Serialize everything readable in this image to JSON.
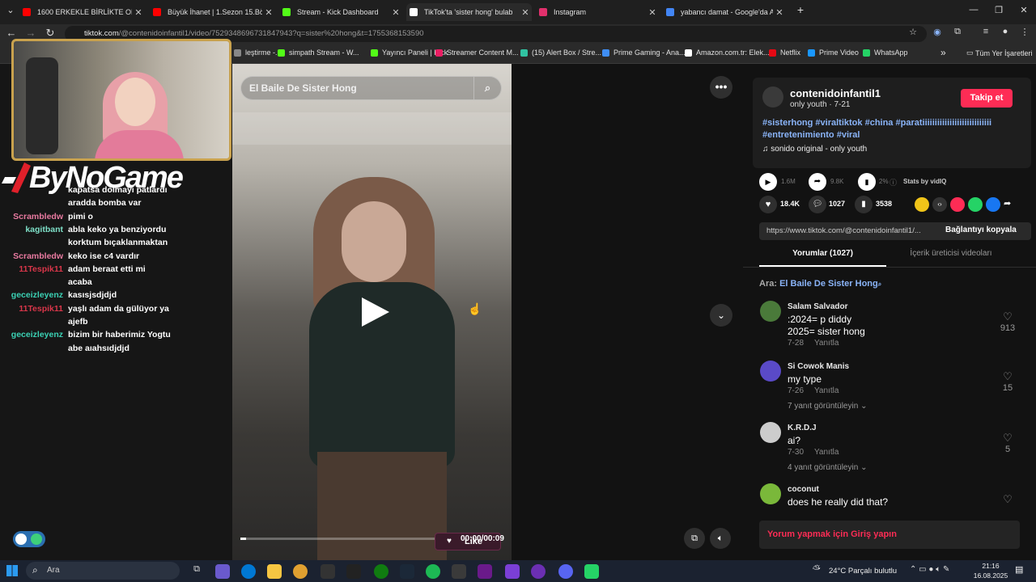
{
  "tabs": [
    {
      "label": "1600 ERKEKLE BİRLİKTE OLUP K",
      "color": "#ff0000"
    },
    {
      "label": "Büyük İhanet | 1.Sezon 15.Bölüm",
      "color": "#ff0000"
    },
    {
      "label": "Stream - Kick Dashboard",
      "color": "#53fc18"
    },
    {
      "label": "TikTok'ta 'sister hong' bulab",
      "color": "#ffffff"
    },
    {
      "label": "Instagram",
      "color": "#e1306c"
    },
    {
      "label": "yabancı damat - Google'da Ara",
      "color": "#4285f4"
    }
  ],
  "new_tab": "+",
  "window": {
    "minimize": "—",
    "restore": "❐",
    "close": "✕"
  },
  "address": {
    "host": "tiktok.com",
    "path": "/@contenidoinfantil1/video/7529348696731847943?q=sister%20hong&t=1755368153590"
  },
  "bookmarks": [
    {
      "label": "leştirme -...",
      "color": "#888888"
    },
    {
      "label": "simpath Stream - W...",
      "color": "#53fc18"
    },
    {
      "label": "Yayıncı Paneli | Kick",
      "color": "#53fc18"
    },
    {
      "label": "Streamer Content M...",
      "color": "#e91e63"
    },
    {
      "label": "(15) Alert Box / Stre...",
      "color": "#31c3a2"
    },
    {
      "label": "Prime Gaming - Ana...",
      "color": "#3f8ef5"
    },
    {
      "label": "Amazon.com.tr: Elek...",
      "color": "#ffffff"
    },
    {
      "label": "Netflix",
      "color": "#e50914"
    },
    {
      "label": "Prime Video",
      "color": "#1a98ff"
    },
    {
      "label": "WhatsApp",
      "color": "#25d366"
    }
  ],
  "bookmarks_more": "»",
  "all_bookmarks": "Tüm Yer İşaretleri",
  "stream": {
    "logo": "ByNoGame",
    "chat": [
      {
        "user": "",
        "msg": "kapatsa dolmayı patlardı",
        "ucolor": "#fff"
      },
      {
        "user": "",
        "msg": "aradda bomba var",
        "ucolor": "#fff"
      },
      {
        "user": "Scrambledw",
        "msg": "pimi o",
        "ucolor": "#e87aa0"
      },
      {
        "user": "kagitbant",
        "msg": "abla keko ya benziyordu",
        "ucolor": "#7ee0c8"
      },
      {
        "user": "",
        "msg": "korktum bıçaklanmaktan",
        "ucolor": "#fff"
      },
      {
        "user": "Scrambledw",
        "msg": "keko ise c4 vardır",
        "ucolor": "#e87aa0"
      },
      {
        "user": "11Tespik11",
        "msg": "adam beraat etti mi",
        "ucolor": "#d9364a"
      },
      {
        "user": "",
        "msg": "acaba",
        "ucolor": "#fff"
      },
      {
        "user": "geceizleyenz",
        "msg": "kasısjsdjdjd",
        "ucolor": "#3bd1b4"
      },
      {
        "user": "11Tespik11",
        "msg": "yaşlı adam da gülüyor ya",
        "ucolor": "#d9364a"
      },
      {
        "user": "",
        "msg": "ajefb",
        "ucolor": "#fff"
      },
      {
        "user": "geceizleyenz",
        "msg": "bizim bir haberimiz Yogtu",
        "ucolor": "#3bd1b4"
      },
      {
        "user": "",
        "msg": "abe aıahsıdjdjd",
        "ucolor": "#fff"
      }
    ]
  },
  "video": {
    "search_text": "El Baile De Sister Hong",
    "time": "00:00/00:09",
    "like_label": "Like",
    "progress": 0.03
  },
  "author": {
    "username": "contenidoinfantil1",
    "subtitle": "only youth · 7-21",
    "follow": "Takip et",
    "caption_tags": [
      "#sisterhong",
      "#viraltiktok",
      "#china",
      "#paratiiiiiiiiiiiiiiiiiiiiiiiiiiii",
      "#entretenimiento",
      "#viral"
    ],
    "sound": "sonido original - only youth"
  },
  "stats": {
    "plays": "1.6M",
    "shares_count": "9.8K",
    "percent": "2%",
    "vidiq": "Stats by vidIQ",
    "likes": "18.4K",
    "comments": "1027",
    "saves": "3538"
  },
  "link": {
    "url": "https://www.tiktok.com/@contenidoinfantil1/...",
    "copy": "Bağlantıyı kopyala"
  },
  "tabs_panel": {
    "comments": "Yorumlar (1027)",
    "creator": "İçerik üreticisi videoları"
  },
  "search_hint": {
    "prefix": "Ara:",
    "term": "El Baile De Sister Hong"
  },
  "comments": [
    {
      "name": "Salam Salvador",
      "text1": ":2024= p diddy",
      "text2": "2025= sister hong",
      "date": "7-28",
      "reply": "Yanıtla",
      "likes": "913",
      "more": "",
      "avatar": "#4a7a3a"
    },
    {
      "name": "Si Cowok Manis",
      "text1": "my type",
      "text2": "",
      "date": "7-26",
      "reply": "Yanıtla",
      "likes": "15",
      "more": "7 yanıt görüntüleyin",
      "avatar": "#5a4ac8"
    },
    {
      "name": "K.R.D.J",
      "text1": "ai?",
      "text2": "",
      "date": "7-30",
      "reply": "Yanıtla",
      "likes": "5",
      "more": "4 yanıt görüntüleyin",
      "avatar": "#cccccc"
    },
    {
      "name": "coconut",
      "text1": "does he really did that?",
      "text2": "",
      "date": "",
      "reply": "",
      "likes": "",
      "more": "",
      "avatar": "#7ab83a"
    }
  ],
  "login_prompt": "Yorum yapmak için Giriş yapın",
  "taskbar": {
    "search": "Ara",
    "weather": "24°C  Parçalı bulutlu",
    "time": "21:16",
    "date": "16.08.2025"
  }
}
